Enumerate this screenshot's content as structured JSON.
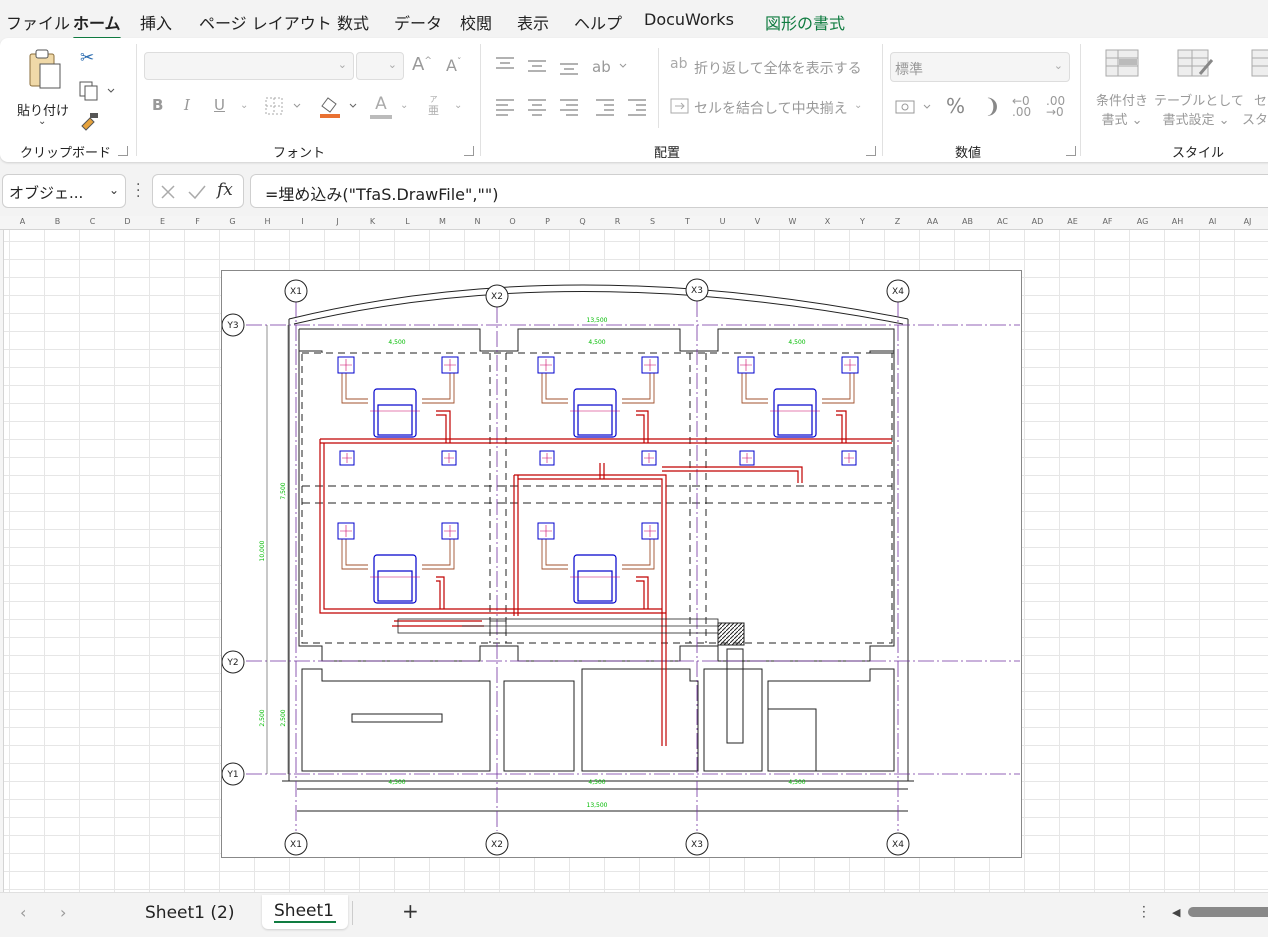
{
  "menu": {
    "tabs": [
      {
        "label": "ファイル"
      },
      {
        "label": "ホーム"
      },
      {
        "label": "挿入"
      },
      {
        "label": "ページ レイアウト"
      },
      {
        "label": "数式"
      },
      {
        "label": "データ"
      },
      {
        "label": "校閲"
      },
      {
        "label": "表示"
      },
      {
        "label": "ヘルプ"
      },
      {
        "label": "DocuWorks"
      },
      {
        "label": "図形の書式"
      }
    ]
  },
  "ribbon": {
    "clipboard": {
      "paste_label": "貼り付け",
      "group_label": "クリップボード"
    },
    "font": {
      "group_label": "フォント",
      "bold": "B",
      "italic": "I",
      "underline": "U",
      "font_color_glyph": "A",
      "phonetic_glyph": "亜"
    },
    "alignment": {
      "group_label": "配置",
      "wrap_text": "折り返して全体を表示する",
      "merge_center": "セルを結合して中央揃え"
    },
    "number": {
      "group_label": "数値",
      "format_value": "標準",
      "percent": "%",
      "comma": "❩"
    },
    "styles": {
      "group_label": "スタイル",
      "conditional_1": "条件付き",
      "conditional_2": "書式",
      "table_1": "テーブルとして",
      "table_2": "書式設定",
      "cell_1": "セル",
      "cell_2": "スタイ"
    }
  },
  "formula_bar": {
    "name_box": "オブジェ...",
    "fx": "fx",
    "formula": "=埋め込み(\"TfaS.DrawFile\",\"\")"
  },
  "columns": [
    "A",
    "B",
    "C",
    "D",
    "E",
    "F",
    "G",
    "H",
    "I",
    "J",
    "K",
    "L",
    "M",
    "N",
    "O",
    "P",
    "Q",
    "R",
    "S",
    "T",
    "U",
    "V",
    "W",
    "X",
    "Y",
    "Z",
    "AA",
    "AB",
    "AC",
    "AD",
    "AE",
    "AF",
    "AG",
    "AH",
    "AI",
    "AJ"
  ],
  "drawing": {
    "grid_x": [
      "X1",
      "X2",
      "X3",
      "X4"
    ],
    "grid_y": [
      "Y3",
      "Y2",
      "Y1"
    ],
    "dims_top_total": "13,500",
    "dims_top_bays": [
      "4,500",
      "4,500",
      "4,500"
    ],
    "dims_bottom_bays": [
      "4,500",
      "4,500",
      "4,500"
    ],
    "dims_bottom_total": "13,500",
    "dim_left_total": "10,000",
    "dim_left_upper": "7,500",
    "dim_left_lower_a": "2,500",
    "dim_left_lower_b": "2,500"
  },
  "sheets": {
    "tabs": [
      {
        "label": "Sheet1 (2)"
      },
      {
        "label": "Sheet1"
      }
    ],
    "active": "Sheet1",
    "add_glyph": "+"
  },
  "colors": {
    "accent": "#107c41",
    "pipe": "#c00000",
    "unit": "#0000cc",
    "gridline": "#7030a0",
    "dimension": "#00cc00"
  }
}
